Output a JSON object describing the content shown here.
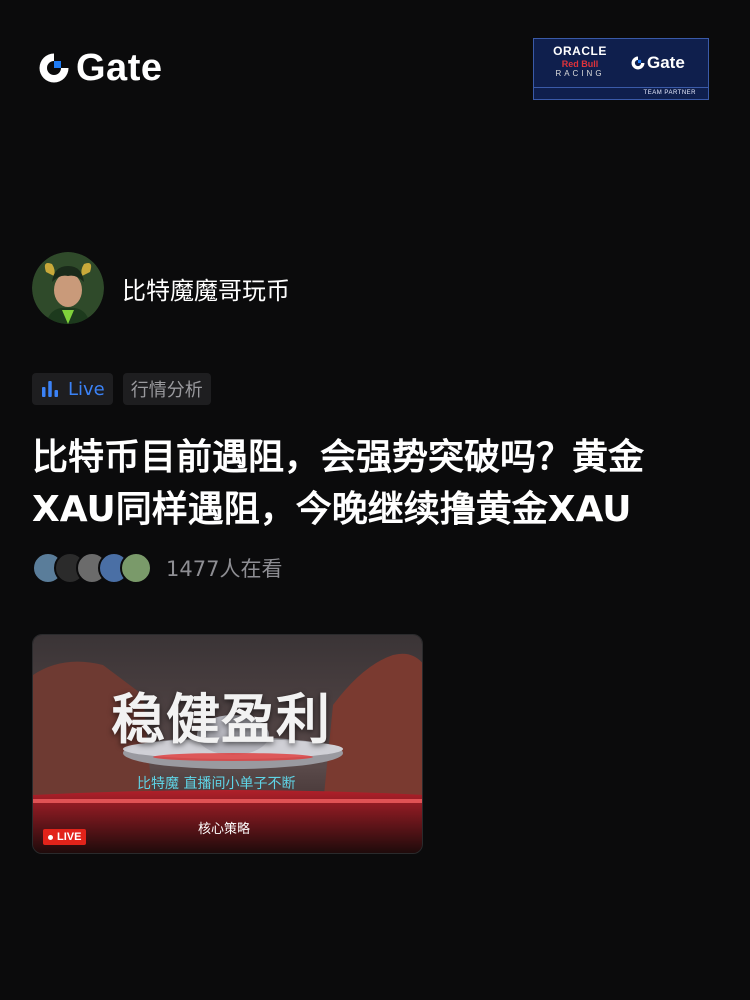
{
  "brand": {
    "name": "Gate",
    "accent": "#1f7cf5"
  },
  "partner": {
    "oracle": "ORACLE",
    "redbull": "Red Bull",
    "racing": "RACING",
    "gate": "Gate",
    "footer": "TEAM PARTNER"
  },
  "author": {
    "name": "比特魔魔哥玩币"
  },
  "tags": {
    "live": "Live",
    "category": "行情分析"
  },
  "post": {
    "title": "比特币目前遇阻，会强势突破吗？黄金XAU同样遇阻，今晚继续撸黄金XAU"
  },
  "viewers": {
    "count_text": "1477人在看"
  },
  "thumbnail": {
    "headline": "稳健盈利",
    "subtitle": "比特魔  直播间小单子不断",
    "strategy": "核心策略",
    "badge": "LIVE"
  }
}
